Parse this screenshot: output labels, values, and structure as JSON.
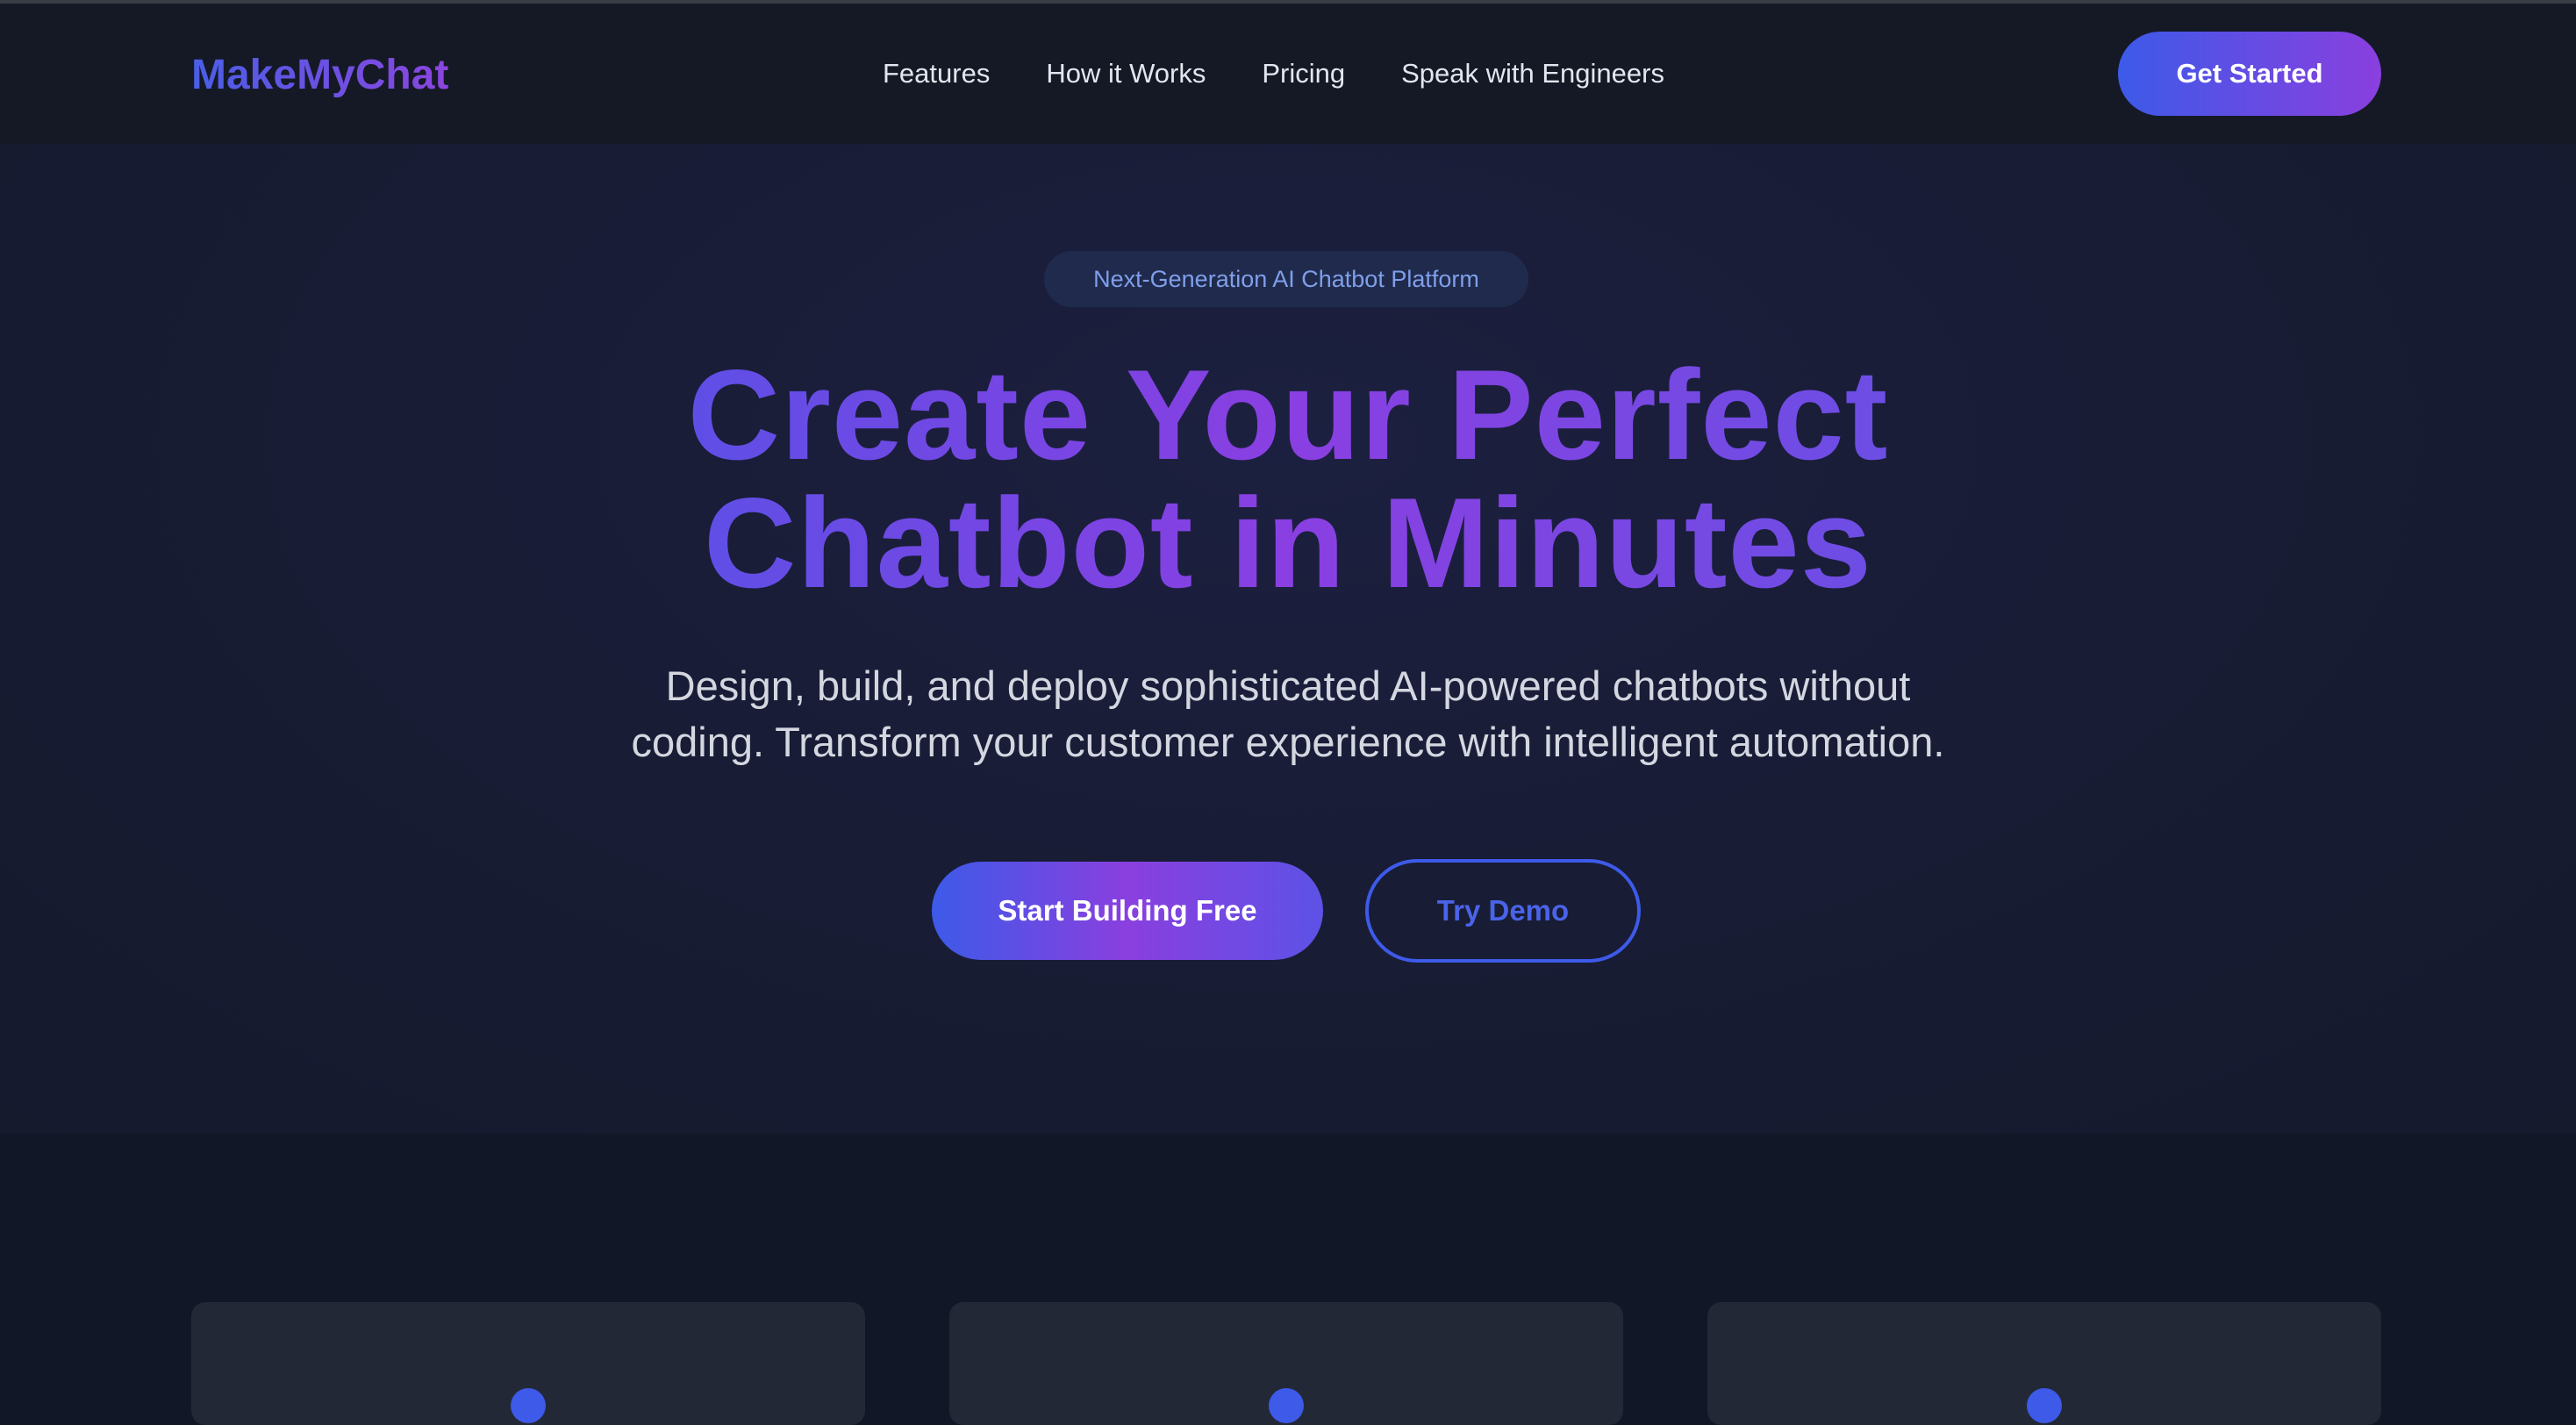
{
  "header": {
    "logo": "MakeMyChat",
    "nav": [
      "Features",
      "How it Works",
      "Pricing",
      "Speak with Engineers"
    ],
    "cta": "Get Started"
  },
  "hero": {
    "badge": "Next-Generation AI Chatbot Platform",
    "title_line1": "Create Your Perfect",
    "title_line2": "Chatbot in Minutes",
    "subtitle_line1": "Design, build, and deploy sophisticated AI-powered chatbots without",
    "subtitle_line2": "coding. Transform your customer experience with intelligent automation.",
    "primary_cta": "Start Building Free",
    "secondary_cta": "Try Demo"
  },
  "features": {
    "cards": [
      {
        "icon": "feature-icon"
      },
      {
        "icon": "feature-icon"
      },
      {
        "icon": "feature-icon"
      }
    ]
  },
  "colors": {
    "accent_blue": "#3d5ae8",
    "accent_purple": "#8a3fdf",
    "background": "#111726",
    "hero_background": "#181c35"
  }
}
